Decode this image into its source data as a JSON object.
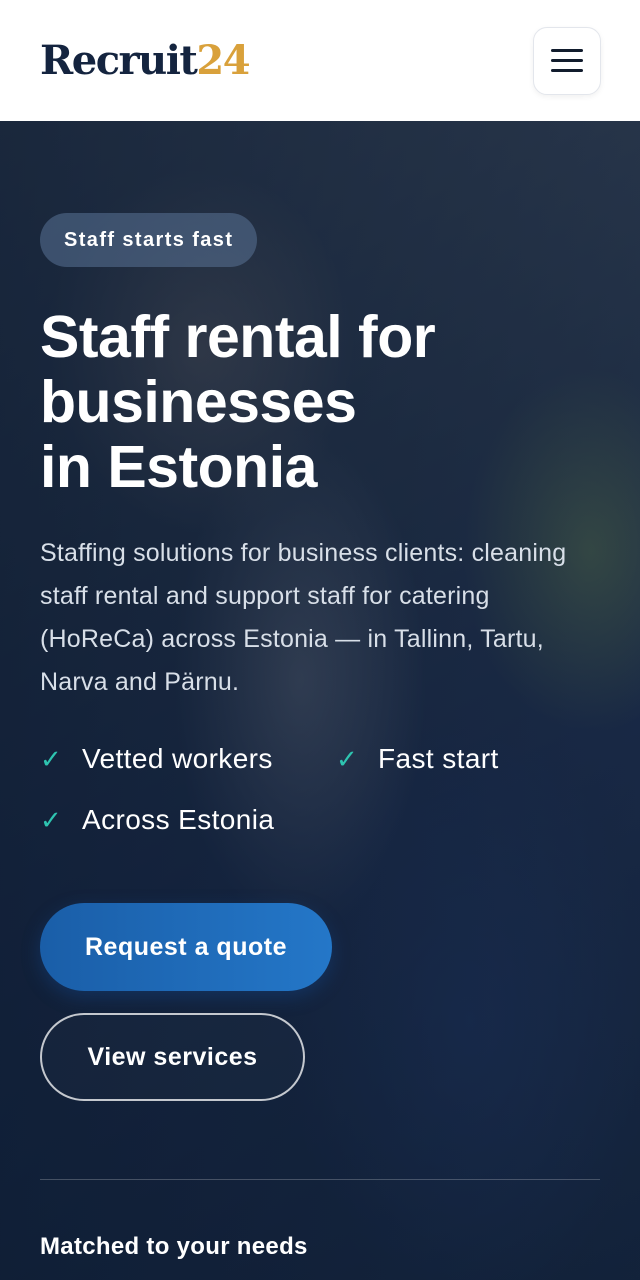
{
  "header": {
    "logo_text": "Recruit",
    "logo_number": "24",
    "menu_icon": "hamburger-menu-icon"
  },
  "hero": {
    "badge": "Staff starts fast",
    "title_lines": [
      "Staff rental for",
      "businesses",
      "in Estonia"
    ],
    "description": "Staffing solutions for business clients: cleaning staff rental and support staff for catering (HoReCa) across Estonia — in Tallinn, Tartu, Narva and Pärnu.",
    "features": [
      {
        "icon": "checkmark-icon",
        "check": "✓",
        "label": "Vetted workers"
      },
      {
        "icon": "checkmark-icon",
        "check": "✓",
        "label": "Fast start"
      },
      {
        "icon": "checkmark-icon",
        "check": "✓",
        "label": "Across Estonia"
      }
    ],
    "primary_button": "Request a quote",
    "secondary_button": "View services",
    "section_label": "Matched to your needs"
  },
  "colors": {
    "brand_dark": "#14243f",
    "brand_gold": "#d9a13b",
    "accent_blue": "#2477c8",
    "check_teal": "#2ec4b0"
  }
}
